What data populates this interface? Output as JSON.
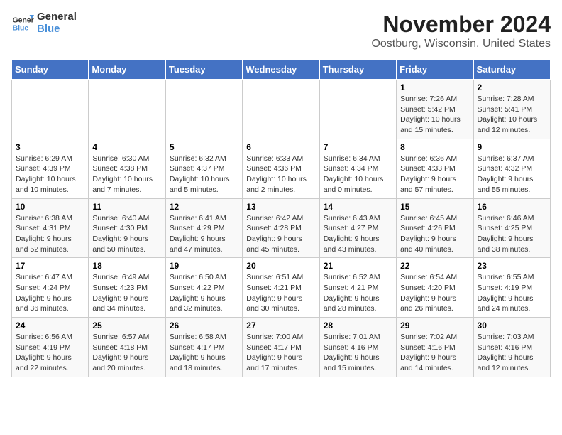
{
  "logo": {
    "line1": "General",
    "line2": "Blue"
  },
  "title": "November 2024",
  "subtitle": "Oostburg, Wisconsin, United States",
  "days_of_week": [
    "Sunday",
    "Monday",
    "Tuesday",
    "Wednesday",
    "Thursday",
    "Friday",
    "Saturday"
  ],
  "weeks": [
    [
      {
        "day": "",
        "info": ""
      },
      {
        "day": "",
        "info": ""
      },
      {
        "day": "",
        "info": ""
      },
      {
        "day": "",
        "info": ""
      },
      {
        "day": "",
        "info": ""
      },
      {
        "day": "1",
        "info": "Sunrise: 7:26 AM\nSunset: 5:42 PM\nDaylight: 10 hours and 15 minutes."
      },
      {
        "day": "2",
        "info": "Sunrise: 7:28 AM\nSunset: 5:41 PM\nDaylight: 10 hours and 12 minutes."
      }
    ],
    [
      {
        "day": "3",
        "info": "Sunrise: 6:29 AM\nSunset: 4:39 PM\nDaylight: 10 hours and 10 minutes."
      },
      {
        "day": "4",
        "info": "Sunrise: 6:30 AM\nSunset: 4:38 PM\nDaylight: 10 hours and 7 minutes."
      },
      {
        "day": "5",
        "info": "Sunrise: 6:32 AM\nSunset: 4:37 PM\nDaylight: 10 hours and 5 minutes."
      },
      {
        "day": "6",
        "info": "Sunrise: 6:33 AM\nSunset: 4:36 PM\nDaylight: 10 hours and 2 minutes."
      },
      {
        "day": "7",
        "info": "Sunrise: 6:34 AM\nSunset: 4:34 PM\nDaylight: 10 hours and 0 minutes."
      },
      {
        "day": "8",
        "info": "Sunrise: 6:36 AM\nSunset: 4:33 PM\nDaylight: 9 hours and 57 minutes."
      },
      {
        "day": "9",
        "info": "Sunrise: 6:37 AM\nSunset: 4:32 PM\nDaylight: 9 hours and 55 minutes."
      }
    ],
    [
      {
        "day": "10",
        "info": "Sunrise: 6:38 AM\nSunset: 4:31 PM\nDaylight: 9 hours and 52 minutes."
      },
      {
        "day": "11",
        "info": "Sunrise: 6:40 AM\nSunset: 4:30 PM\nDaylight: 9 hours and 50 minutes."
      },
      {
        "day": "12",
        "info": "Sunrise: 6:41 AM\nSunset: 4:29 PM\nDaylight: 9 hours and 47 minutes."
      },
      {
        "day": "13",
        "info": "Sunrise: 6:42 AM\nSunset: 4:28 PM\nDaylight: 9 hours and 45 minutes."
      },
      {
        "day": "14",
        "info": "Sunrise: 6:43 AM\nSunset: 4:27 PM\nDaylight: 9 hours and 43 minutes."
      },
      {
        "day": "15",
        "info": "Sunrise: 6:45 AM\nSunset: 4:26 PM\nDaylight: 9 hours and 40 minutes."
      },
      {
        "day": "16",
        "info": "Sunrise: 6:46 AM\nSunset: 4:25 PM\nDaylight: 9 hours and 38 minutes."
      }
    ],
    [
      {
        "day": "17",
        "info": "Sunrise: 6:47 AM\nSunset: 4:24 PM\nDaylight: 9 hours and 36 minutes."
      },
      {
        "day": "18",
        "info": "Sunrise: 6:49 AM\nSunset: 4:23 PM\nDaylight: 9 hours and 34 minutes."
      },
      {
        "day": "19",
        "info": "Sunrise: 6:50 AM\nSunset: 4:22 PM\nDaylight: 9 hours and 32 minutes."
      },
      {
        "day": "20",
        "info": "Sunrise: 6:51 AM\nSunset: 4:21 PM\nDaylight: 9 hours and 30 minutes."
      },
      {
        "day": "21",
        "info": "Sunrise: 6:52 AM\nSunset: 4:21 PM\nDaylight: 9 hours and 28 minutes."
      },
      {
        "day": "22",
        "info": "Sunrise: 6:54 AM\nSunset: 4:20 PM\nDaylight: 9 hours and 26 minutes."
      },
      {
        "day": "23",
        "info": "Sunrise: 6:55 AM\nSunset: 4:19 PM\nDaylight: 9 hours and 24 minutes."
      }
    ],
    [
      {
        "day": "24",
        "info": "Sunrise: 6:56 AM\nSunset: 4:19 PM\nDaylight: 9 hours and 22 minutes."
      },
      {
        "day": "25",
        "info": "Sunrise: 6:57 AM\nSunset: 4:18 PM\nDaylight: 9 hours and 20 minutes."
      },
      {
        "day": "26",
        "info": "Sunrise: 6:58 AM\nSunset: 4:17 PM\nDaylight: 9 hours and 18 minutes."
      },
      {
        "day": "27",
        "info": "Sunrise: 7:00 AM\nSunset: 4:17 PM\nDaylight: 9 hours and 17 minutes."
      },
      {
        "day": "28",
        "info": "Sunrise: 7:01 AM\nSunset: 4:16 PM\nDaylight: 9 hours and 15 minutes."
      },
      {
        "day": "29",
        "info": "Sunrise: 7:02 AM\nSunset: 4:16 PM\nDaylight: 9 hours and 14 minutes."
      },
      {
        "day": "30",
        "info": "Sunrise: 7:03 AM\nSunset: 4:16 PM\nDaylight: 9 hours and 12 minutes."
      }
    ]
  ]
}
